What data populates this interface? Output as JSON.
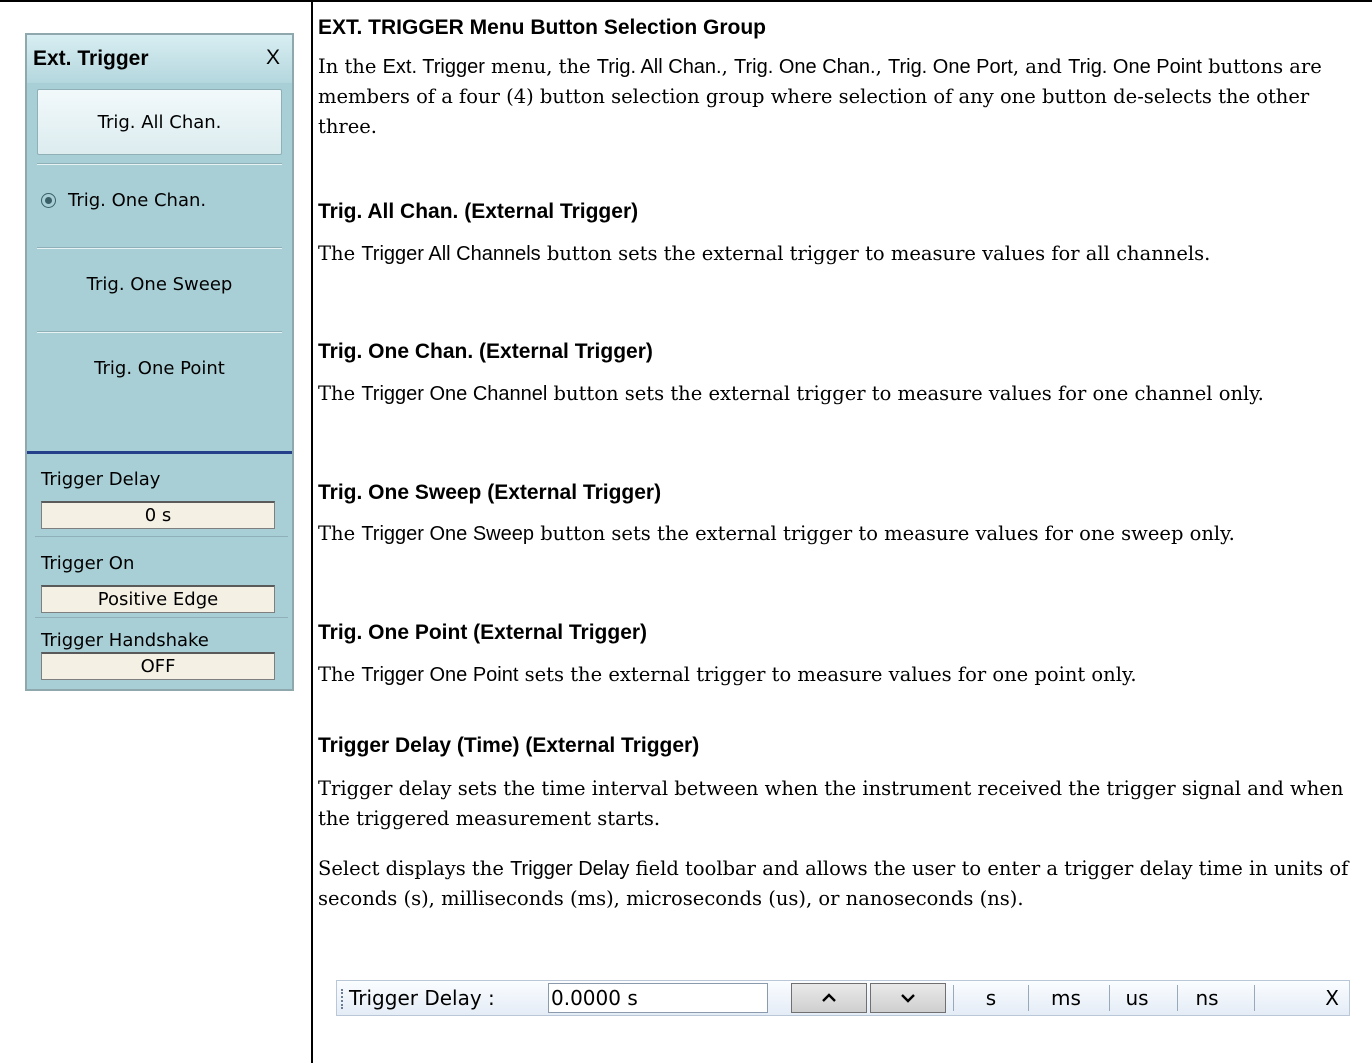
{
  "panel": {
    "title": "Ext. Trigger",
    "close_label": "X",
    "buttons": [
      "Trig. All Chan.",
      "Trig. One Chan.",
      "Trig. One Sweep",
      "Trig. One Point"
    ],
    "selected_index": 1,
    "fields": [
      {
        "label": "Trigger Delay",
        "value": "0 s"
      },
      {
        "label": "Trigger On",
        "value": "Positive Edge"
      },
      {
        "label": "Trigger Handshake",
        "value": "OFF"
      }
    ]
  },
  "doc": {
    "s1": {
      "heading": "EXT. TRIGGER Menu Button Selection Group",
      "p1_a": "In the ",
      "p1_b": "Ext. Trigger",
      "p1_c": " menu, the ",
      "p1_d": "Trig. All Chan.",
      "p1_e": ", ",
      "p1_f": "Trig. One Chan.",
      "p1_g": ", ",
      "p1_h": "Trig. One Port",
      "p1_i": ", and ",
      "p1_j": "Trig. One Point",
      "p1_k": " buttons are members of a four (4) button selection group where selection of any one button de-selects the other three."
    },
    "s2": {
      "heading": "Trig. All Chan. (External Trigger)",
      "p_a": "The ",
      "p_b": "Trigger All Channels",
      "p_c": " button sets the external trigger to measure values for all channels."
    },
    "s3": {
      "heading": "Trig. One Chan. (External Trigger)",
      "p_a": "The ",
      "p_b": "Trigger One Channel",
      "p_c": " button sets the external trigger to measure values for one channel only."
    },
    "s4": {
      "heading": "Trig. One Sweep (External Trigger)",
      "p_a": "The ",
      "p_b": "Trigger One Sweep",
      "p_c": " button sets the external trigger to measure values for one sweep only."
    },
    "s5": {
      "heading": "Trig. One Point (External Trigger)",
      "p_a": "The ",
      "p_b": "Trigger One Point",
      "p_c": " sets the external trigger to measure values for one point only."
    },
    "s6": {
      "heading": "Trigger Delay (Time) (External Trigger)",
      "p1": "Trigger delay sets the time interval between when the instrument received the trigger signal and when the triggered measurement starts.",
      "p2_a": "Select displays the ",
      "p2_b": "Trigger Delay",
      "p2_c": " field toolbar and allows the user to enter a trigger delay time in units of seconds (s), milliseconds (ms), microseconds (us), or nanoseconds (ns)."
    }
  },
  "toolbar": {
    "label": "Trigger Delay  :",
    "value": "0.0000  s",
    "up_icon": "chevron-up-icon",
    "down_icon": "chevron-down-icon",
    "units": [
      "s",
      "ms",
      "us",
      "ns"
    ],
    "close_label": "X"
  }
}
